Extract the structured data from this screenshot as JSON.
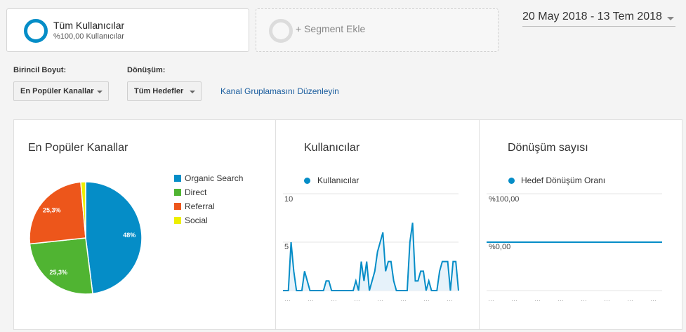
{
  "segments": {
    "all_users_title": "Tüm Kullanıcılar",
    "all_users_sub": "%100,00 Kullanıcılar",
    "add_segment": "+ Segment Ekle"
  },
  "date_range": "20 May 2018 - 13 Tem 2018",
  "controls": {
    "primary_dimension_label": "Birincil Boyut:",
    "primary_dimension_value": "En Popüler Kanallar",
    "conversion_label": "Dönüşüm:",
    "conversion_value": "Tüm Hedefler",
    "edit_link": "Kanal Gruplamasını Düzenleyin"
  },
  "colors": {
    "organic": "#058dc7",
    "direct": "#50b432",
    "referral": "#ed561b",
    "social": "#edef00",
    "line": "#058dc7"
  },
  "chart_data": [
    {
      "type": "pie",
      "title": "En Popüler Kanallar",
      "categories": [
        "Organic Search",
        "Direct",
        "Referral",
        "Social"
      ],
      "values": [
        48,
        25.3,
        25.3,
        1.4
      ],
      "labels": [
        "48%",
        "25,3%",
        "25,3%",
        ""
      ]
    },
    {
      "type": "area",
      "title": "Kullanıcılar",
      "series": [
        {
          "name": "Kullanıcılar",
          "values": [
            0,
            0,
            0,
            5,
            2,
            0,
            0,
            0,
            2,
            1,
            0,
            0,
            0,
            0,
            0,
            0,
            1,
            1,
            0,
            0,
            0,
            0,
            0,
            0,
            0,
            0,
            0,
            1,
            0,
            3,
            1,
            3,
            0,
            1,
            2,
            4,
            5,
            6,
            2,
            3,
            3,
            1,
            0,
            0,
            0,
            0,
            0,
            5,
            7,
            1,
            1,
            2,
            2,
            0,
            1,
            0,
            0,
            0,
            2,
            3,
            3,
            3,
            0,
            3,
            3,
            0
          ]
        }
      ],
      "yticks": [
        "10",
        "5"
      ],
      "ylim": [
        0,
        10
      ]
    },
    {
      "type": "line",
      "title": "Dönüşüm sayısı",
      "series": [
        {
          "name": "Hedef Dönüşüm Oranı",
          "values": [
            0,
            0
          ]
        }
      ],
      "yticks": [
        "%100,00",
        "%0,00"
      ],
      "ylim": [
        0,
        100
      ]
    }
  ]
}
